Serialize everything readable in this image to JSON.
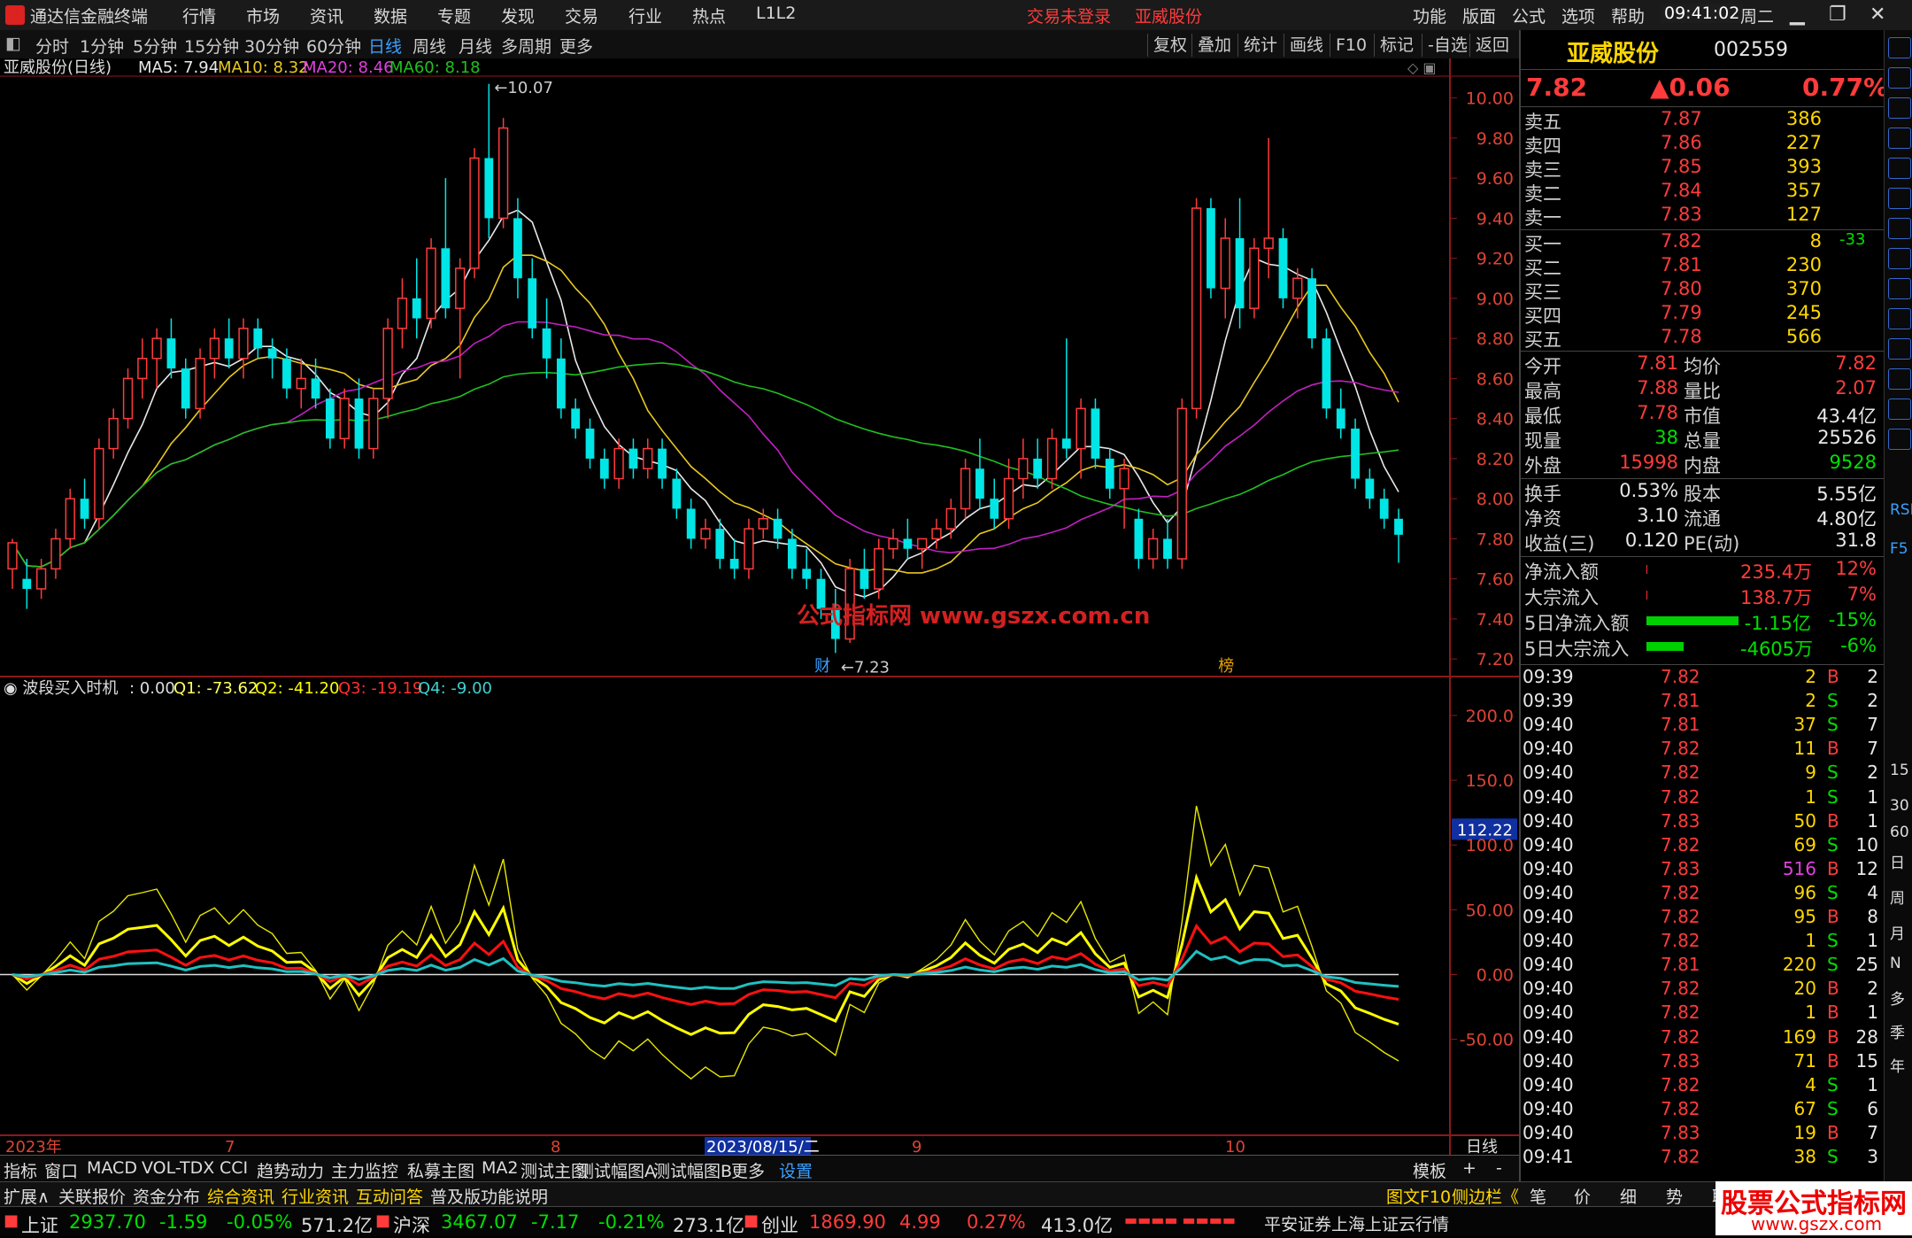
{
  "app": {
    "title": "通达信金融终端",
    "login": "交易未登录",
    "stock_title": "亚威股份",
    "time": "09:41:02",
    "weekday": "周二"
  },
  "menu": [
    "行情",
    "市场",
    "资讯",
    "数据",
    "专题",
    "发现",
    "交易",
    "行业",
    "热点",
    "L1L2"
  ],
  "menu_right": [
    "功能",
    "版面",
    "公式",
    "选项",
    "帮助"
  ],
  "periods": [
    "分时",
    "1分钟",
    "5分钟",
    "15分钟",
    "30分钟",
    "60分钟",
    "日线",
    "周线",
    "月线",
    "多周期",
    "更多"
  ],
  "period_selected": "日线",
  "toolbar": [
    "复权",
    "叠加",
    "统计",
    "画线",
    "F10",
    "标记",
    "-自选",
    "返回"
  ],
  "main_legend": {
    "name": "亚威股份(日线)",
    "ma5": "MA5: 7.94",
    "ma10": "MA10: 8.32",
    "ma20": "MA20: 8.46",
    "ma60": "MA60: 8.18"
  },
  "price_axis": [
    "10.00",
    "9.80",
    "9.60",
    "9.40",
    "9.20",
    "9.00",
    "8.80",
    "8.60",
    "8.40",
    "8.20",
    "8.00",
    "7.80",
    "7.60",
    "7.40",
    "7.20"
  ],
  "high_label": "10.07",
  "low_label": "7.23",
  "watermark": "公式指标网  www.gszx.com.cn",
  "event_marks": [
    "财",
    "榜"
  ],
  "sub_legend": {
    "name": "波段买入时机",
    "v0": ": 0.00",
    "q1": "Q1: -73.62",
    "q2": "Q2: -41.20",
    "q3": "Q3: -19.19",
    "q4": "Q4: -9.00"
  },
  "sub_axis": [
    "200.0",
    "150.0",
    "100.0",
    "50.00",
    "0.00",
    "-50.00"
  ],
  "sub_cursor_value": "112.22",
  "date_axis": [
    "2023年",
    "7",
    "8",
    "2023/08/15/二",
    "9",
    "10"
  ],
  "date_axis_right": "日线",
  "chart_data": {
    "type": "candlestick",
    "ylim": [
      7.13,
      10.1
    ],
    "candles_ohlc": [
      [
        7.65,
        7.8,
        7.55,
        7.78
      ],
      [
        7.6,
        7.7,
        7.45,
        7.55
      ],
      [
        7.55,
        7.7,
        7.5,
        7.65
      ],
      [
        7.65,
        7.85,
        7.6,
        7.8
      ],
      [
        7.8,
        8.05,
        7.75,
        8.0
      ],
      [
        8.0,
        8.1,
        7.85,
        7.9
      ],
      [
        7.9,
        8.3,
        7.85,
        8.25
      ],
      [
        8.25,
        8.45,
        8.2,
        8.4
      ],
      [
        8.4,
        8.65,
        8.35,
        8.6
      ],
      [
        8.6,
        8.8,
        8.5,
        8.7
      ],
      [
        8.7,
        8.85,
        8.55,
        8.8
      ],
      [
        8.8,
        8.9,
        8.6,
        8.65
      ],
      [
        8.65,
        8.7,
        8.4,
        8.45
      ],
      [
        8.45,
        8.75,
        8.4,
        8.7
      ],
      [
        8.7,
        8.85,
        8.6,
        8.8
      ],
      [
        8.8,
        8.9,
        8.65,
        8.7
      ],
      [
        8.7,
        8.9,
        8.6,
        8.85
      ],
      [
        8.85,
        8.9,
        8.7,
        8.75
      ],
      [
        8.75,
        8.8,
        8.6,
        8.7
      ],
      [
        8.7,
        8.75,
        8.5,
        8.55
      ],
      [
        8.55,
        8.7,
        8.45,
        8.6
      ],
      [
        8.6,
        8.7,
        8.45,
        8.5
      ],
      [
        8.5,
        8.55,
        8.25,
        8.3
      ],
      [
        8.3,
        8.55,
        8.25,
        8.5
      ],
      [
        8.5,
        8.6,
        8.2,
        8.25
      ],
      [
        8.25,
        8.55,
        8.2,
        8.5
      ],
      [
        8.5,
        8.9,
        8.4,
        8.85
      ],
      [
        8.85,
        9.1,
        8.75,
        9.0
      ],
      [
        9.0,
        9.2,
        8.8,
        8.9
      ],
      [
        8.9,
        9.3,
        8.85,
        9.25
      ],
      [
        9.25,
        9.6,
        8.9,
        8.95
      ],
      [
        8.95,
        9.2,
        8.6,
        9.15
      ],
      [
        9.15,
        9.75,
        9.1,
        9.7
      ],
      [
        9.7,
        10.07,
        9.3,
        9.4
      ],
      [
        9.4,
        9.9,
        9.35,
        9.85
      ],
      [
        9.4,
        9.5,
        9.0,
        9.1
      ],
      [
        9.1,
        9.2,
        8.8,
        8.85
      ],
      [
        8.85,
        9.0,
        8.6,
        8.7
      ],
      [
        8.7,
        8.8,
        8.4,
        8.45
      ],
      [
        8.45,
        8.5,
        8.3,
        8.35
      ],
      [
        8.35,
        8.4,
        8.15,
        8.2
      ],
      [
        8.2,
        8.25,
        8.05,
        8.1
      ],
      [
        8.1,
        8.3,
        8.05,
        8.25
      ],
      [
        8.25,
        8.3,
        8.1,
        8.15
      ],
      [
        8.15,
        8.3,
        8.1,
        8.25
      ],
      [
        8.25,
        8.3,
        8.05,
        8.1
      ],
      [
        8.1,
        8.15,
        7.9,
        7.95
      ],
      [
        7.95,
        8.0,
        7.75,
        7.8
      ],
      [
        7.8,
        7.9,
        7.75,
        7.85
      ],
      [
        7.85,
        7.9,
        7.65,
        7.7
      ],
      [
        7.7,
        7.8,
        7.6,
        7.65
      ],
      [
        7.65,
        7.9,
        7.6,
        7.85
      ],
      [
        7.85,
        7.95,
        7.8,
        7.9
      ],
      [
        7.9,
        7.95,
        7.75,
        7.8
      ],
      [
        7.8,
        7.85,
        7.6,
        7.65
      ],
      [
        7.65,
        7.75,
        7.55,
        7.6
      ],
      [
        7.6,
        7.65,
        7.4,
        7.45
      ],
      [
        7.45,
        7.55,
        7.23,
        7.3
      ],
      [
        7.3,
        7.7,
        7.28,
        7.65
      ],
      [
        7.65,
        7.75,
        7.5,
        7.55
      ],
      [
        7.55,
        7.8,
        7.5,
        7.75
      ],
      [
        7.75,
        7.85,
        7.7,
        7.8
      ],
      [
        7.8,
        7.9,
        7.7,
        7.75
      ],
      [
        7.75,
        7.8,
        7.65,
        7.8
      ],
      [
        7.8,
        7.9,
        7.75,
        7.85
      ],
      [
        7.85,
        8.0,
        7.8,
        7.95
      ],
      [
        7.95,
        8.2,
        7.9,
        8.15
      ],
      [
        8.15,
        8.3,
        7.95,
        8.0
      ],
      [
        8.0,
        8.1,
        7.85,
        7.9
      ],
      [
        7.9,
        8.2,
        7.85,
        8.1
      ],
      [
        8.1,
        8.3,
        8.0,
        8.2
      ],
      [
        8.2,
        8.3,
        8.05,
        8.1
      ],
      [
        8.1,
        8.35,
        8.05,
        8.3
      ],
      [
        8.3,
        8.8,
        8.2,
        8.25
      ],
      [
        8.25,
        8.5,
        8.1,
        8.45
      ],
      [
        8.45,
        8.5,
        8.15,
        8.2
      ],
      [
        8.2,
        8.25,
        8.0,
        8.05
      ],
      [
        8.05,
        8.2,
        7.85,
        8.15
      ],
      [
        7.9,
        7.95,
        7.65,
        7.7
      ],
      [
        7.7,
        7.85,
        7.65,
        7.8
      ],
      [
        7.8,
        7.9,
        7.65,
        7.7
      ],
      [
        7.7,
        8.5,
        7.65,
        8.45
      ],
      [
        8.45,
        9.5,
        8.4,
        9.45
      ],
      [
        9.45,
        9.5,
        9.0,
        9.05
      ],
      [
        9.05,
        9.4,
        8.9,
        9.3
      ],
      [
        9.3,
        9.5,
        8.85,
        8.95
      ],
      [
        8.95,
        9.3,
        8.9,
        9.25
      ],
      [
        9.25,
        9.8,
        9.1,
        9.3
      ],
      [
        9.3,
        9.35,
        8.95,
        9.0
      ],
      [
        9.0,
        9.15,
        8.9,
        9.1
      ],
      [
        9.1,
        9.15,
        8.75,
        8.8
      ],
      [
        8.8,
        8.85,
        8.4,
        8.45
      ],
      [
        8.45,
        8.55,
        8.3,
        8.35
      ],
      [
        8.35,
        8.4,
        8.05,
        8.1
      ],
      [
        8.1,
        8.15,
        7.95,
        8.0
      ],
      [
        8.0,
        8.05,
        7.85,
        7.9
      ],
      [
        7.9,
        7.95,
        7.68,
        7.82
      ]
    ]
  },
  "quote": {
    "name": "亚威股份",
    "code": "002559",
    "price": "7.82",
    "change": "▲0.06",
    "pct": "0.77%",
    "sell": [
      {
        "l": "卖五",
        "p": "7.87",
        "v": "386"
      },
      {
        "l": "卖四",
        "p": "7.86",
        "v": "227"
      },
      {
        "l": "卖三",
        "p": "7.85",
        "v": "393"
      },
      {
        "l": "卖二",
        "p": "7.84",
        "v": "357"
      },
      {
        "l": "卖一",
        "p": "7.83",
        "v": "127"
      }
    ],
    "buy": [
      {
        "l": "买一",
        "p": "7.82",
        "v": "8",
        "d": "-33"
      },
      {
        "l": "买二",
        "p": "7.81",
        "v": "230",
        "d": ""
      },
      {
        "l": "买三",
        "p": "7.80",
        "v": "370",
        "d": ""
      },
      {
        "l": "买四",
        "p": "7.79",
        "v": "245",
        "d": ""
      },
      {
        "l": "买五",
        "p": "7.78",
        "v": "566",
        "d": ""
      }
    ],
    "stats": [
      {
        "a": "今开",
        "av": "7.81",
        "b": "均价",
        "bv": "7.82"
      },
      {
        "a": "最高",
        "av": "7.88",
        "b": "量比",
        "bv": "2.07"
      },
      {
        "a": "最低",
        "av": "7.78",
        "b": "市值",
        "bv": "43.4亿"
      },
      {
        "a": "现量",
        "av": "38",
        "b": "总量",
        "bv": "25526"
      },
      {
        "a": "外盘",
        "av": "15998",
        "b": "内盘",
        "bv": "9528"
      }
    ],
    "stats2": [
      {
        "a": "换手",
        "av": "0.53%",
        "b": "股本",
        "bv": "5.55亿"
      },
      {
        "a": "净资",
        "av": "3.10",
        "b": "流通",
        "bv": "4.80亿"
      },
      {
        "a": "收益(三)",
        "av": "0.120",
        "b": "PE(动)",
        "bv": "31.8"
      }
    ],
    "flows": [
      {
        "l": "净流入额",
        "v": "235.4万",
        "p": "12%",
        "bar": 0.01
      },
      {
        "l": "大宗流入",
        "v": "138.7万",
        "p": "7%",
        "bar": 0.01
      },
      {
        "l": "5日净流入额",
        "v": "-1.15亿",
        "p": "-15%",
        "bar": 1.0
      },
      {
        "l": "5日大宗流入",
        "v": "-4605万",
        "p": "-6%",
        "bar": 0.4
      }
    ],
    "ticks": [
      {
        "t": "09:39",
        "p": "7.82",
        "v": "2",
        "s": "B",
        "n": "2"
      },
      {
        "t": "09:39",
        "p": "7.81",
        "v": "2",
        "s": "S",
        "n": "2"
      },
      {
        "t": "09:40",
        "p": "7.81",
        "v": "37",
        "s": "S",
        "n": "7"
      },
      {
        "t": "09:40",
        "p": "7.82",
        "v": "11",
        "s": "B",
        "n": "7"
      },
      {
        "t": "09:40",
        "p": "7.82",
        "v": "9",
        "s": "S",
        "n": "2"
      },
      {
        "t": "09:40",
        "p": "7.82",
        "v": "1",
        "s": "S",
        "n": "1"
      },
      {
        "t": "09:40",
        "p": "7.83",
        "v": "50",
        "s": "B",
        "n": "1"
      },
      {
        "t": "09:40",
        "p": "7.82",
        "v": "69",
        "s": "S",
        "n": "10"
      },
      {
        "t": "09:40",
        "p": "7.83",
        "v": "516",
        "s": "B",
        "n": "12"
      },
      {
        "t": "09:40",
        "p": "7.82",
        "v": "96",
        "s": "S",
        "n": "4"
      },
      {
        "t": "09:40",
        "p": "7.82",
        "v": "95",
        "s": "B",
        "n": "8"
      },
      {
        "t": "09:40",
        "p": "7.82",
        "v": "1",
        "s": "S",
        "n": "1"
      },
      {
        "t": "09:40",
        "p": "7.81",
        "v": "220",
        "s": "S",
        "n": "25"
      },
      {
        "t": "09:40",
        "p": "7.82",
        "v": "20",
        "s": "B",
        "n": "2"
      },
      {
        "t": "09:40",
        "p": "7.82",
        "v": "1",
        "s": "B",
        "n": "1"
      },
      {
        "t": "09:40",
        "p": "7.82",
        "v": "169",
        "s": "B",
        "n": "28"
      },
      {
        "t": "09:40",
        "p": "7.83",
        "v": "71",
        "s": "B",
        "n": "15"
      },
      {
        "t": "09:40",
        "p": "7.82",
        "v": "4",
        "s": "S",
        "n": "1"
      },
      {
        "t": "09:40",
        "p": "7.82",
        "v": "67",
        "s": "S",
        "n": "6"
      },
      {
        "t": "09:40",
        "p": "7.83",
        "v": "19",
        "s": "B",
        "n": "7"
      },
      {
        "t": "09:41",
        "p": "7.82",
        "v": "38",
        "s": "S",
        "n": "3"
      }
    ]
  },
  "right_tools": [
    "日",
    "周",
    "月",
    "N",
    "多",
    "季",
    "年",
    "15",
    "30",
    "60",
    "RSI",
    "F5"
  ],
  "indicator_tabs": [
    "指标",
    "窗口",
    "MACD",
    "VOL-TDX",
    "CCI",
    "趋势动力",
    "主力监控",
    "私募主图",
    "MA2",
    "测试主图",
    "测试幅图A",
    "测试幅图B",
    "更多",
    "设置"
  ],
  "indicator_tabs_right": [
    "模板",
    "+",
    "-"
  ],
  "func_tabs": [
    "扩展∧",
    "关联报价",
    "资金分布",
    "综合资讯",
    "行业资讯",
    "互动问答",
    "普及版功能说明"
  ],
  "func_tabs_right": [
    "图文F10",
    "侧边栏《",
    "笔",
    "价",
    "细",
    "势",
    "联"
  ],
  "status": [
    {
      "n": "上证",
      "v": "2937.70",
      "c": "-1.59",
      "p": "-0.05%",
      "a": "571.2亿"
    },
    {
      "n": "沪深",
      "v": "3467.07",
      "c": "-7.17",
      "p": "-0.21%",
      "a": "273.1亿"
    },
    {
      "n": "创业",
      "v": "1869.90",
      "c": "4.99",
      "p": "0.27%",
      "a": "413.0亿"
    }
  ],
  "status_right": "平安证券上海上证云行情",
  "brand": {
    "line1": "股票公式指标网",
    "line2": "www.gszx.com"
  },
  "colors": {
    "up": "#ff3b3b",
    "down": "#00e5e5",
    "ma5": "#e8e8e8",
    "ma10": "#e8c820",
    "ma20": "#c020c0",
    "ma60": "#20c020"
  }
}
